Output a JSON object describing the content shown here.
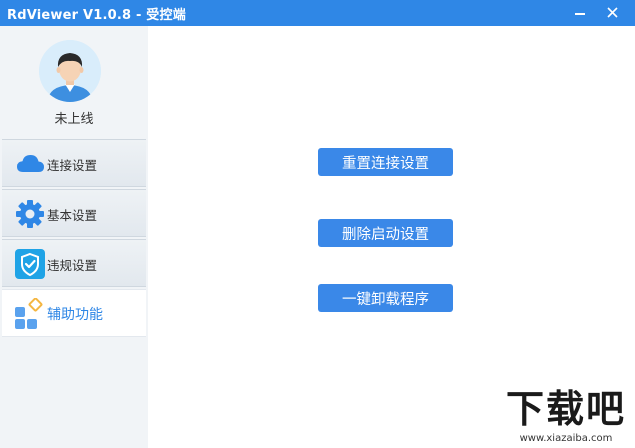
{
  "window": {
    "title": "RdViewer V1.0.8 - 受控端"
  },
  "sidebar": {
    "status": "未上线",
    "items": [
      {
        "label": "连接设置",
        "icon": "cloud-icon"
      },
      {
        "label": "基本设置",
        "icon": "gear-icon"
      },
      {
        "label": "违规设置",
        "icon": "shield-check-icon"
      },
      {
        "label": "辅助功能",
        "icon": "apps-grid-icon",
        "active": true
      }
    ]
  },
  "main": {
    "buttons": [
      "重置连接设置",
      "删除启动设置",
      "一键卸载程序"
    ]
  },
  "watermark": {
    "main": "下载吧",
    "sub": "www.xiazaiba.com"
  },
  "colors": {
    "accent": "#2f87e6",
    "button": "#3a88e8",
    "sidebar_bg": "#f1f4f7"
  }
}
